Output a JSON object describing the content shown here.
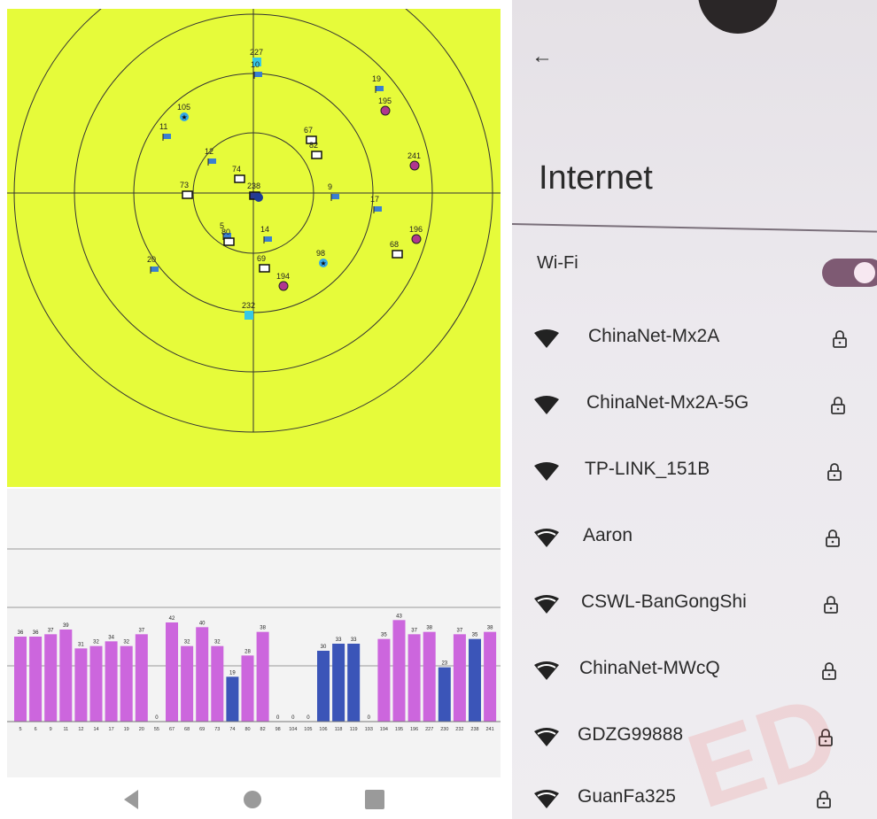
{
  "gps_sky_view": {
    "satellites": [
      {
        "id": "227",
        "type": "square",
        "fill": "#35c8e6"
      },
      {
        "id": "10",
        "type": "flag",
        "fill": "#3a7fd0"
      },
      {
        "id": "19",
        "type": "flag",
        "fill": "#3a7fd0"
      },
      {
        "id": "195",
        "type": "circle",
        "fill": "#b0368f"
      },
      {
        "id": "105",
        "type": "star",
        "fill": "#35a8e6"
      },
      {
        "id": "11",
        "type": "flag",
        "fill": "#3a7fd0"
      },
      {
        "id": "67",
        "type": "flagbox",
        "fill": "#ffffff"
      },
      {
        "id": "82",
        "type": "flagbox",
        "fill": "#ffffff"
      },
      {
        "id": "241",
        "type": "circle",
        "fill": "#b0368f"
      },
      {
        "id": "12",
        "type": "flag",
        "fill": "#3a7fd0"
      },
      {
        "id": "74",
        "type": "flagbox",
        "fill": "#ffffff"
      },
      {
        "id": "73",
        "type": "flagbox",
        "fill": "#ffffff"
      },
      {
        "id": "9",
        "type": "flag",
        "fill": "#3a7fd0"
      },
      {
        "id": "17",
        "type": "flag",
        "fill": "#3a7fd0"
      },
      {
        "id": "5",
        "type": "flag",
        "fill": "#3a7fd0"
      },
      {
        "id": "80",
        "type": "flagbox",
        "fill": "#ffffff"
      },
      {
        "id": "14",
        "type": "flag",
        "fill": "#3a7fd0"
      },
      {
        "id": "196",
        "type": "circle",
        "fill": "#b0368f"
      },
      {
        "id": "68",
        "type": "flagbox",
        "fill": "#ffffff"
      },
      {
        "id": "20",
        "type": "flag",
        "fill": "#3a7fd0"
      },
      {
        "id": "98",
        "type": "star",
        "fill": "#35a8e6"
      },
      {
        "id": "69",
        "type": "flagbox",
        "fill": "#ffffff"
      },
      {
        "id": "194",
        "type": "circle",
        "fill": "#b0368f"
      },
      {
        "id": "232",
        "type": "square",
        "fill": "#35c8e6"
      },
      {
        "id": "238",
        "type": "flagbox",
        "fill": "#2b3a8f"
      }
    ]
  },
  "signal_bars": {
    "bars": [
      {
        "label": "5",
        "value": 36,
        "color": "purple"
      },
      {
        "label": "6",
        "value": 36,
        "color": "purple"
      },
      {
        "label": "9",
        "value": 37,
        "color": "purple"
      },
      {
        "label": "11",
        "value": 39,
        "color": "purple"
      },
      {
        "label": "12",
        "value": 31,
        "color": "purple"
      },
      {
        "label": "14",
        "value": 32,
        "color": "purple"
      },
      {
        "label": "17",
        "value": 34,
        "color": "purple"
      },
      {
        "label": "19",
        "value": 32,
        "color": "purple"
      },
      {
        "label": "20",
        "value": 37,
        "color": "purple"
      },
      {
        "label": "55",
        "value": 0,
        "color": "none"
      },
      {
        "label": "67",
        "value": 42,
        "color": "purple"
      },
      {
        "label": "68",
        "value": 32,
        "color": "purple"
      },
      {
        "label": "69",
        "value": 40,
        "color": "purple"
      },
      {
        "label": "73",
        "value": 32,
        "color": "purple"
      },
      {
        "label": "74",
        "value": 19,
        "color": "blue"
      },
      {
        "label": "80",
        "value": 28,
        "color": "purple"
      },
      {
        "label": "82",
        "value": 38,
        "color": "purple"
      },
      {
        "label": "98",
        "value": 0,
        "color": "none"
      },
      {
        "label": "104",
        "value": 0,
        "color": "none"
      },
      {
        "label": "105",
        "value": 0,
        "color": "none"
      },
      {
        "label": "106",
        "value": 30,
        "color": "blue"
      },
      {
        "label": "118",
        "value": 33,
        "color": "blue"
      },
      {
        "label": "119",
        "value": 33,
        "color": "blue"
      },
      {
        "label": "193",
        "value": 0,
        "color": "none"
      },
      {
        "label": "194",
        "value": 35,
        "color": "purple"
      },
      {
        "label": "195",
        "value": 43,
        "color": "purple"
      },
      {
        "label": "196",
        "value": 37,
        "color": "purple"
      },
      {
        "label": "227",
        "value": 38,
        "color": "purple"
      },
      {
        "label": "230",
        "value": 23,
        "color": "blue"
      },
      {
        "label": "232",
        "value": 37,
        "color": "purple"
      },
      {
        "label": "238",
        "value": 35,
        "color": "blue"
      },
      {
        "label": "241",
        "value": 38,
        "color": "purple"
      }
    ],
    "colors": {
      "purple": "#cc66dd",
      "blue": "#3b55b8"
    }
  },
  "internet": {
    "title": "Internet",
    "wifi_label": "Wi-Fi",
    "wifi_on": true,
    "networks": [
      {
        "name": "ChinaNet-Mx2A",
        "signal": "full",
        "locked": true
      },
      {
        "name": "ChinaNet-Mx2A-5G",
        "signal": "full",
        "locked": true
      },
      {
        "name": "TP-LINK_151B",
        "signal": "full",
        "locked": true
      },
      {
        "name": "Aaron",
        "signal": "medium",
        "locked": true
      },
      {
        "name": "CSWL-BanGongShi",
        "signal": "medium",
        "locked": true
      },
      {
        "name": "ChinaNet-MWcQ",
        "signal": "medium",
        "locked": true
      },
      {
        "name": "GDZG99888",
        "signal": "medium",
        "locked": true
      },
      {
        "name": "GuanFa325",
        "signal": "medium",
        "locked": true
      }
    ]
  }
}
